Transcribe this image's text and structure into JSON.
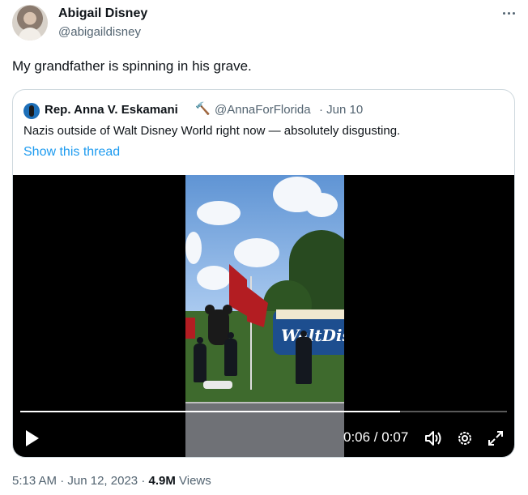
{
  "tweet": {
    "author": {
      "name": "Abigail Disney",
      "handle": "@abigaildisney"
    },
    "text": "My grandfather is spinning in his grave.",
    "meta": {
      "time": "5:13 AM",
      "separator": "·",
      "date": "Jun 12, 2023",
      "views_count": "4.9M",
      "views_label": "Views"
    }
  },
  "quote": {
    "author": {
      "name": "Rep. Anna V. Eskamani",
      "emoji": "🔨",
      "handle": "@AnnaForFlorida",
      "date": "· Jun 10"
    },
    "text": "Nazis outside of Walt Disney World right now — absolutely disgusting.",
    "show_thread": "Show this thread",
    "video": {
      "current_time": "0:06",
      "duration": "0:07",
      "time_display": "0:06 / 0:07",
      "progress": 0.78,
      "controls": [
        "play-icon",
        "volume-icon",
        "settings-icon",
        "fullscreen-icon"
      ]
    }
  },
  "icons": {
    "more": "more-icon"
  },
  "colors": {
    "link": "#1d9bf0",
    "secondary_text": "#536471",
    "border": "#cfd9de"
  }
}
